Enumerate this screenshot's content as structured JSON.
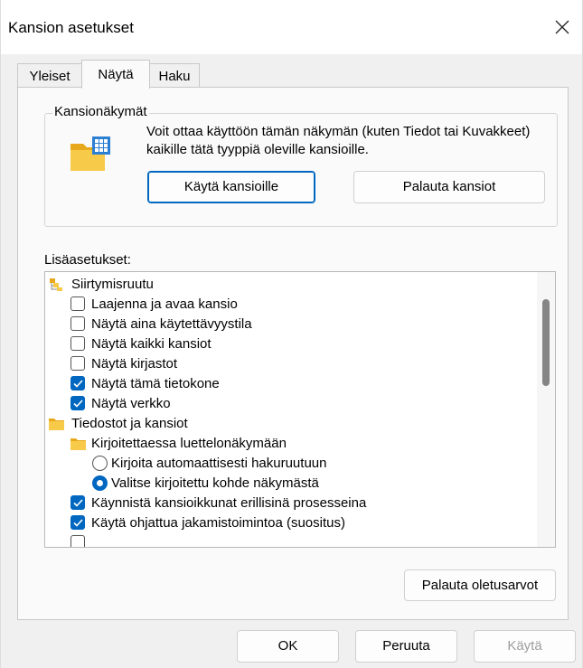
{
  "window": {
    "title": "Kansion asetukset"
  },
  "tabs": [
    {
      "label": "Yleiset",
      "active": false
    },
    {
      "label": "Näytä",
      "active": true
    },
    {
      "label": "Haku",
      "active": false
    }
  ],
  "folder_views": {
    "legend": "Kansionäkymät",
    "description": "Voit ottaa käyttöön tämän näkymän (kuten Tiedot tai Kuvakkeet) kaikille tätä tyyppiä oleville kansioille.",
    "apply_button": "Käytä kansioille",
    "reset_button": "Palauta kansiot"
  },
  "advanced": {
    "label": "Lisäasetukset:",
    "items": [
      {
        "type": "group",
        "icon": "navigation-pane-icon",
        "label": "Siirtymisruutu"
      },
      {
        "type": "checkbox",
        "checked": false,
        "label": "Laajenna ja avaa kansio"
      },
      {
        "type": "checkbox",
        "checked": false,
        "label": "Näytä aina käytettävyystila"
      },
      {
        "type": "checkbox",
        "checked": false,
        "label": "Näytä kaikki kansiot"
      },
      {
        "type": "checkbox",
        "checked": false,
        "label": "Näytä kirjastot"
      },
      {
        "type": "checkbox",
        "checked": true,
        "label": "Näytä tämä tietokone"
      },
      {
        "type": "checkbox",
        "checked": true,
        "label": "Näytä verkko"
      },
      {
        "type": "group",
        "icon": "folder-icon",
        "label": "Tiedostot ja kansiot"
      },
      {
        "type": "subgroup",
        "icon": "folder-icon",
        "label": "Kirjoitettaessa luettelonäkymään"
      },
      {
        "type": "radio",
        "checked": false,
        "label": "Kirjoita automaattisesti hakuruutuun"
      },
      {
        "type": "radio",
        "checked": true,
        "label": "Valitse kirjoitettu kohde näkymästä"
      },
      {
        "type": "checkbox",
        "checked": true,
        "label": "Käynnistä kansioikkunat erillisinä prosesseina"
      },
      {
        "type": "checkbox",
        "checked": true,
        "label": "Käytä ohjattua jakamistoimintoa (suositus)"
      },
      {
        "type": "checkbox",
        "checked": false,
        "label": ""
      }
    ]
  },
  "restore_defaults_button": "Palauta oletusarvot",
  "footer": {
    "ok": "OK",
    "cancel": "Peruuta",
    "apply": "Käytä"
  },
  "colors": {
    "accent": "#0067c0",
    "folder": "#f5c342"
  }
}
